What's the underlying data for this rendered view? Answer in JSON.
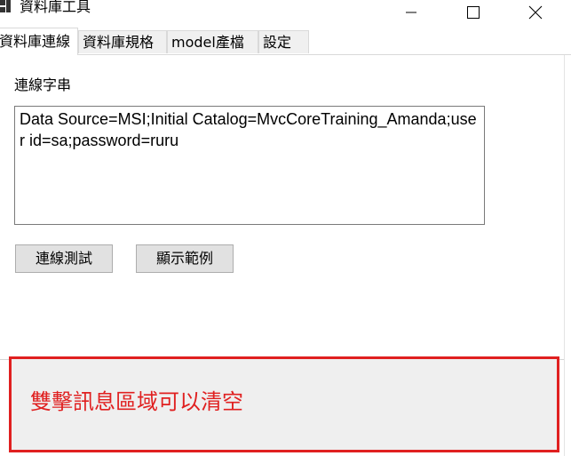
{
  "window": {
    "title": "資料庫工具"
  },
  "tabs": [
    {
      "label": "資料庫連線",
      "active": true
    },
    {
      "label": "資料庫規格",
      "active": false
    },
    {
      "label": "model產檔",
      "active": false
    },
    {
      "label": "設定",
      "active": false
    }
  ],
  "connection": {
    "label": "連線字串",
    "value": "Data Source=MSI;Initial Catalog=MvcCoreTraining_Amanda;user id=sa;password=ruru",
    "test_button": "連線測試",
    "sample_button": "顯示範例"
  },
  "message": {
    "text": "雙擊訊息區域可以清空",
    "color": "#e02020"
  },
  "icons": {
    "title": "app-icon",
    "minimize": "minimize-icon",
    "maximize": "maximize-icon",
    "close": "close-icon"
  }
}
